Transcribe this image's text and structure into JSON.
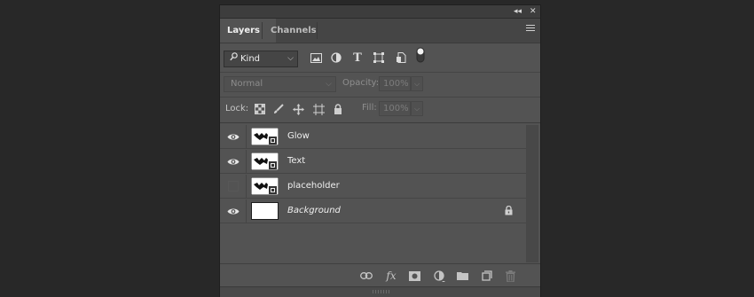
{
  "titlebar": {
    "collapse_glyph": "◂◂",
    "close_glyph": "✕"
  },
  "tabs": [
    {
      "label": "Layers",
      "active": true
    },
    {
      "label": "Channels",
      "active": false
    }
  ],
  "filter": {
    "kind_label": "Kind",
    "icons": [
      "pixel-layer-filter-icon",
      "adjustment-layer-filter-icon",
      "type-layer-filter-icon",
      "shape-layer-filter-icon",
      "smart-object-filter-icon",
      "filter-toggle-icon"
    ]
  },
  "blend": {
    "mode": "Normal",
    "opacity_label": "Opacity:",
    "opacity_value": "100%"
  },
  "lock": {
    "label": "Lock:",
    "icons": [
      "lock-transparent-pixels-icon",
      "lock-image-pixels-icon",
      "lock-position-icon",
      "lock-artboard-icon",
      "lock-all-icon"
    ],
    "fill_label": "Fill:",
    "fill_value": "100%"
  },
  "layers": [
    {
      "name": "Glow",
      "visible": true,
      "thumb": "smart-object",
      "italic": false,
      "locked": false
    },
    {
      "name": "Text",
      "visible": true,
      "thumb": "smart-object",
      "italic": false,
      "locked": false
    },
    {
      "name": "placeholder",
      "visible": false,
      "thumb": "smart-object",
      "italic": false,
      "locked": false
    },
    {
      "name": "Background",
      "visible": true,
      "thumb": "white",
      "italic": true,
      "locked": true
    }
  ],
  "bottom_icons": [
    "link-layers-icon",
    "fx-icon",
    "add-mask-icon",
    "new-adjustment-layer-icon",
    "new-group-icon",
    "new-layer-icon",
    "delete-layer-icon"
  ],
  "bottom_fx_text": "fx",
  "colors": {
    "panel": "#535353",
    "background": "#282828",
    "tab_bar": "#454545"
  }
}
